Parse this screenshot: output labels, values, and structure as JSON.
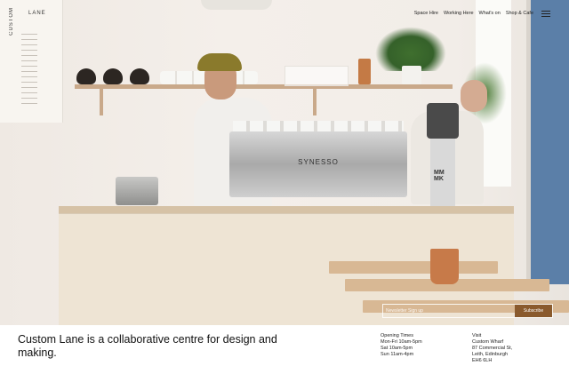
{
  "poster": {
    "logo_vertical": "CUSTOM",
    "logo_horizontal": "LANE"
  },
  "machine": {
    "brand": "SYNESSO"
  },
  "grinder": {
    "label": "MM\nMK"
  },
  "nav": {
    "items": [
      "Space Hire",
      "Working Here",
      "What's on",
      "Shop & Cafe"
    ]
  },
  "subscribe": {
    "placeholder": "Newsletter Sign up",
    "button": "Subscribe"
  },
  "footer": {
    "tagline": "Custom Lane is a collaborative centre for design and making.",
    "opening": {
      "heading": "Opening Times",
      "lines": [
        "Mon-Fri 10am-5pm",
        "Sat 10am-5pm",
        "Sun 11am-4pm"
      ]
    },
    "visit": {
      "heading": "Visit",
      "lines": [
        "Custom Wharf",
        "87 Commercial St,",
        "Leith, Edinburgh",
        "EH6 6LH"
      ]
    }
  }
}
